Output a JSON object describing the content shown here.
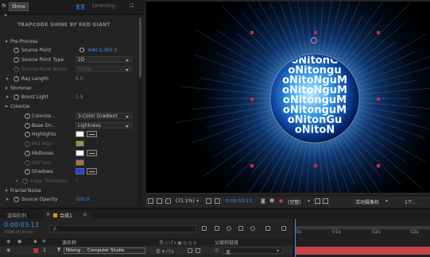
{
  "effect_controls": {
    "fx_label": "fx",
    "tab": "Shine",
    "reset": "重置",
    "licensing": "Licensing...",
    "header_title": "TRAPCODE SHINE BY RED GIANT",
    "properties": {
      "pre_process": "Pre-Process",
      "source_point": {
        "label": "Source Point",
        "value": "640.0,360.0"
      },
      "source_point_type": {
        "label": "Source Point Type",
        "value": "2D"
      },
      "source_point_name": {
        "label": "Source Point Name",
        "value": "Shine"
      },
      "ray_length": {
        "label": "Ray Length",
        "value": "5.0"
      },
      "shimmer": "Shimmer",
      "boost_light": {
        "label": "Boost Light",
        "value": "1.9"
      },
      "colorize_group": "Colorize",
      "colorize": {
        "label": "Colorize...",
        "value": "3-Color Gradient"
      },
      "base_on": {
        "label": "Base On...",
        "value": "Lightness"
      },
      "highlights": {
        "label": "Highlights",
        "color": "#ffffff"
      },
      "mid_high": {
        "label": "Mid High",
        "color": "#f6d46a"
      },
      "midtones": {
        "label": "Midtones",
        "color": "#ffffff"
      },
      "mid_low": {
        "label": "Mid Low",
        "color": "#f2ae7c"
      },
      "shadows": {
        "label": "Shadows",
        "color": "#1848ee"
      },
      "edge_thickness": {
        "label": "Edge Thickness",
        "value": "1"
      },
      "fractal_noise": "Fractal Noise",
      "source_opacity": {
        "label": "Source Opacity",
        "value": "100.0"
      }
    }
  },
  "viewer": {
    "globe_text": [
      "oNitonG",
      "oNitongu",
      "oNitoNguM",
      "oNitoNguM",
      "oNitonguM",
      "oNitonguM",
      "oNitonGu",
      "oNitoN"
    ],
    "toolbar": {
      "zoom": "(71.1%)",
      "timecode": "0:00:03:13",
      "resolution": "(完整)",
      "camera": "活动摄像机",
      "views": "1个..."
    }
  },
  "timeline": {
    "tabs": [
      "渲染队列",
      "合成1"
    ],
    "timecode": "0:00:03:13",
    "frame_info": "00088 (25.00 fps)",
    "search_placeholder": "ρ.",
    "col_source": "源名称",
    "col_parent": "父级和链接",
    "layer": {
      "number": "1",
      "type": "T",
      "name": "Nitong ... Computer Studio",
      "parent": "无"
    },
    "ruler": [
      "0s",
      "01s",
      "02s",
      "02s"
    ]
  },
  "colors": {
    "accent": "#3d8fe0",
    "timeline_bar": "#c9434b",
    "handle": "#c93030"
  }
}
